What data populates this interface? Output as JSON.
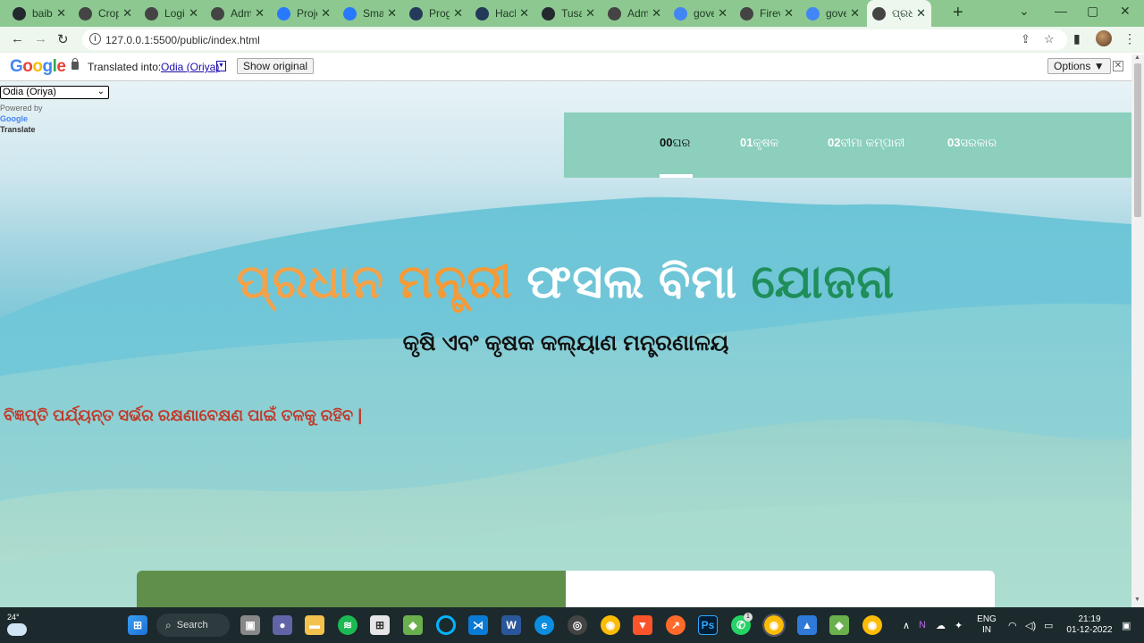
{
  "browser": {
    "tabs": [
      {
        "title": "baibi",
        "icon": "github-icon",
        "color": "#24292e"
      },
      {
        "title": "Crop",
        "icon": "globe-icon",
        "color": "#444444"
      },
      {
        "title": "Login",
        "icon": "globe-icon",
        "color": "#444444"
      },
      {
        "title": "Adm",
        "icon": "globe-icon",
        "color": "#444444"
      },
      {
        "title": "Proje",
        "icon": "c-icon",
        "color": "#2979ff"
      },
      {
        "title": "Smar",
        "icon": "c-icon",
        "color": "#2979ff"
      },
      {
        "title": "Prog",
        "icon": "h-icon",
        "color": "#233a59"
      },
      {
        "title": "Hack",
        "icon": "h-icon",
        "color": "#233a59"
      },
      {
        "title": "Tusa",
        "icon": "github-icon",
        "color": "#24292e"
      },
      {
        "title": "Adm",
        "icon": "globe-icon",
        "color": "#444444"
      },
      {
        "title": "gove",
        "icon": "google-icon",
        "color": "#4285f4"
      },
      {
        "title": "Firev",
        "icon": "globe-icon",
        "color": "#444444"
      },
      {
        "title": "gove",
        "icon": "google-icon",
        "color": "#4285f4"
      },
      {
        "title": "ପ୍ରଧା",
        "icon": "globe-icon",
        "color": "#444444",
        "active": true
      }
    ],
    "url": "127.0.0.1:5500/public/index.html"
  },
  "translate_bar": {
    "logo": "Google",
    "label": "Translated into:",
    "language": "Odia (Oriya)",
    "show_original": "Show original",
    "options": "Options ▼"
  },
  "page": {
    "gt_select_value": "Odia (Oriya)",
    "powered_by": "Powered by",
    "powered_google": "Google",
    "powered_translate": "Translate",
    "nav": [
      {
        "num": "00",
        "label": "ଘର",
        "active": true
      },
      {
        "num": "01",
        "label": "କୃଷକ"
      },
      {
        "num": "02",
        "label": "ବୀମା କମ୍ପାନୀ"
      },
      {
        "num": "03",
        "label": "ସରକାର"
      }
    ],
    "hero": {
      "w1": "ପ୍ରଧାନ",
      "w2": "ମନ୍ତ୍ରୀ",
      "w3": "ଫସଲ",
      "w4": "ବିମା",
      "w5": "ଯୋଜନା",
      "subtitle": "କୃଷି ଏବଂ କୃଷକ କଲ୍ୟାଣ ମନ୍ତ୍ରଣାଳୟ"
    },
    "notice": "ବିଜ୍ଞପ୍ତି ପର୍ଯ୍ୟନ୍ତ ସର୍ଭର ରକ୍ଷଣାବେକ୍ଷଣ ପାଇଁ ତଳକୁ ରହିବ |"
  },
  "taskbar": {
    "temperature": "24°",
    "search": "Search",
    "lang_line1": "ENG",
    "lang_line2": "IN",
    "time": "21:19",
    "date": "01-12-2022",
    "whatsapp_badge": "1"
  }
}
